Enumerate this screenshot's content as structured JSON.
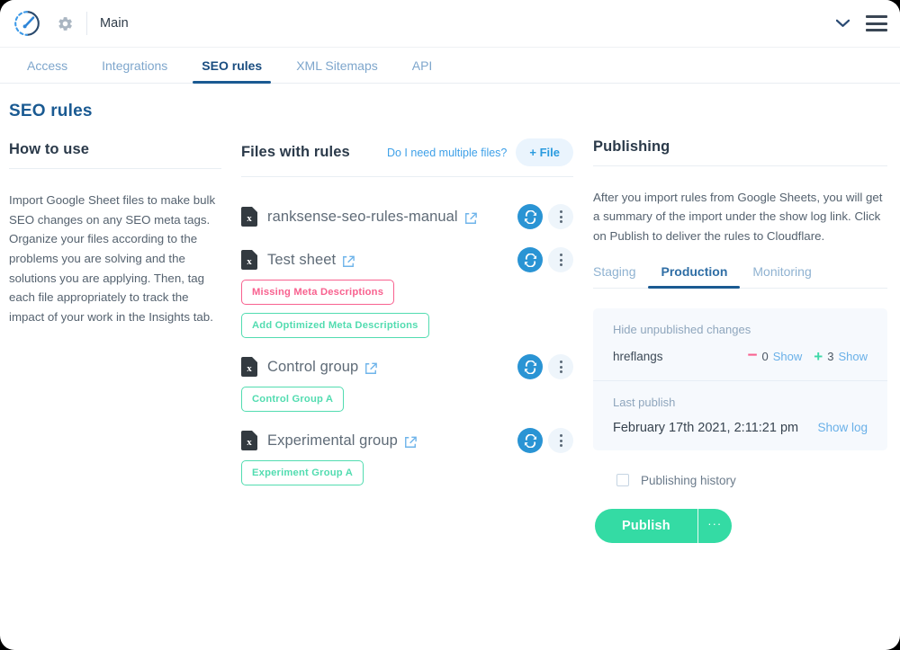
{
  "header": {
    "logo_icon": "speedometer-logo-icon",
    "gear_icon": "gear-icon",
    "title": "Main",
    "chevron_icon": "chevron-down-icon",
    "menu_icon": "hamburger-menu-icon"
  },
  "tabs": [
    {
      "label": "Access",
      "active": false
    },
    {
      "label": "Integrations",
      "active": false
    },
    {
      "label": "SEO rules",
      "active": true
    },
    {
      "label": "XML Sitemaps",
      "active": false
    },
    {
      "label": "API",
      "active": false
    }
  ],
  "left": {
    "page_title": "SEO rules",
    "section_title": "How to use",
    "body": "Import Google Sheet files to make bulk SEO changes on any SEO meta tags. Organize your files according to the problems you are solving and the solutions you are applying. Then, tag each file appropriately to track the impact of your work in the Insights tab."
  },
  "middle": {
    "section_title": "Files with rules",
    "helper_link": "Do I need multiple files?",
    "add_file_label": "+ File",
    "files": [
      {
        "name": "ranksense-seo-rules-manual",
        "icon": "excel-file-icon",
        "tags": []
      },
      {
        "name": "Test sheet",
        "icon": "excel-file-icon",
        "tags": [
          {
            "label": "Missing Meta Descriptions",
            "color": "#f8618f"
          },
          {
            "label": "Add Optimized Meta Descriptions",
            "color": "#52dcb0"
          }
        ]
      },
      {
        "name": "Control group",
        "icon": "excel-file-icon",
        "tags": [
          {
            "label": "Control Group A",
            "color": "#52dcb0"
          }
        ]
      },
      {
        "name": "Experimental group",
        "icon": "excel-file-icon",
        "tags": [
          {
            "label": "Experiment Group A",
            "color": "#52dcb0"
          }
        ]
      }
    ]
  },
  "right": {
    "section_title": "Publishing",
    "description": "After you import rules from Google Sheets, you will get a summary of the import under the show log link. Click on Publish to deliver the rules to Cloudflare.",
    "subtabs": [
      {
        "label": "Staging",
        "active": false
      },
      {
        "label": "Production",
        "active": true
      },
      {
        "label": "Monitoring",
        "active": false
      }
    ],
    "changes": {
      "toggle_label": "Hide unpublished changes",
      "row_key": "hreflangs",
      "removed_count": "0",
      "removed_show": "Show",
      "added_count": "3",
      "added_show": "Show"
    },
    "last_publish": {
      "label": "Last publish",
      "date": "February 17th 2021, 2:11:21 pm",
      "show_log": "Show log"
    },
    "history_label": "Publishing history",
    "publish_label": "Publish",
    "publish_more_label": "···"
  },
  "colors": {
    "accent_blue": "#1a5a92",
    "link_blue": "#3ea0e8",
    "green": "#34dba4",
    "pink": "#f8618f"
  }
}
